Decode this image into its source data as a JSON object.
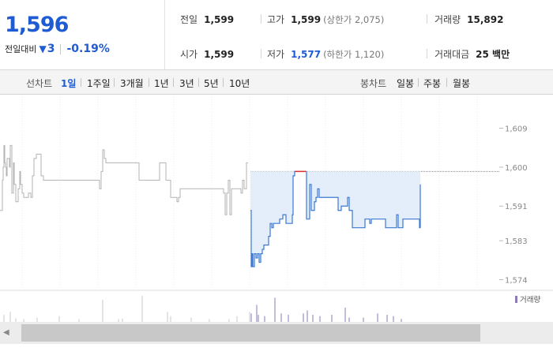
{
  "quote": {
    "price": "1,596",
    "change_label": "전일대비",
    "change_symbol": "▼",
    "change_abs": "3",
    "change_pct": "-0.19%"
  },
  "stats": {
    "prev_close_label": "전일",
    "prev_close": "1,599",
    "high_label": "고가",
    "high": "1,599",
    "upper_limit": "(상한가 2,075)",
    "volume_label": "거래량",
    "volume": "15,892",
    "open_label": "시가",
    "open": "1,599",
    "low_label": "저가",
    "low": "1,577",
    "lower_limit": "(하한가 1,120)",
    "amount_label": "거래대금",
    "amount": "25 백만"
  },
  "toolbar": {
    "line_label": "선차트",
    "line_periods": [
      "1일",
      "1주일",
      "3개월",
      "1년",
      "3년",
      "5년",
      "10년"
    ],
    "active_period": "1일",
    "candle_label": "봉차트",
    "candle_periods": [
      "일봉",
      "주봉",
      "월봉"
    ]
  },
  "colors": {
    "accent": "#1f5bd3",
    "today_line": "#3a78d4",
    "today_fill": "#e4eefb",
    "prev_line": "#b3b3b3",
    "up": "#e03030",
    "volume": "#8a7ab8"
  },
  "chart_data": {
    "type": "line",
    "ylim": [
      1573,
      1610
    ],
    "ytick_labels": [
      "1,609",
      "1,600",
      "1,591",
      "1,583",
      "1,574"
    ],
    "yticks": [
      1609,
      1600,
      1591,
      1583,
      1574
    ],
    "reference_price": 1599,
    "volume_legend": "거래량",
    "series": [
      {
        "x": [
          0,
          3,
          4,
          5,
          6,
          7,
          8,
          9,
          12,
          13,
          15,
          17,
          18,
          20,
          23,
          25,
          26,
          28,
          30,
          33,
          36,
          39,
          41,
          43,
          46,
          52,
          55,
          58,
          62,
          65,
          70,
          80,
          95,
          105,
          115,
          120,
          122,
          126,
          128,
          130,
          132,
          134,
          136,
          140,
          155,
          170,
          176,
          178,
          180,
          182,
          186,
          198,
          202,
          205,
          207,
          210,
          212,
          214,
          216,
          220,
          224,
          226,
          228,
          236,
          250,
          265,
          275,
          280,
          283,
          285,
          287,
          289,
          291,
          293,
          298,
          303,
          305,
          307,
          309,
          312,
          314
        ],
        "y": [
          1590,
          1597,
          1600,
          1605,
          1601,
          1600,
          1598,
          1602,
          1600,
          1605,
          1594,
          1601,
          1596,
          1592,
          1595,
          1599,
          1596,
          1594,
          1593,
          1593,
          1594,
          1593,
          1598,
          1602,
          1603,
          1598,
          1597,
          1597,
          1597,
          1597,
          1597,
          1597,
          1597,
          1597,
          1597,
          1597,
          1597,
          1595,
          1599,
          1604,
          1602,
          1601,
          1601,
          1601,
          1601,
          1601,
          1597,
          1597,
          1597,
          1597,
          1597,
          1597,
          1601,
          1601,
          1601,
          1597,
          1597,
          1597,
          1593,
          1593,
          1592,
          1593,
          1595,
          1595,
          1595,
          1595,
          1595,
          1595,
          1594,
          1589,
          1594,
          1597,
          1589,
          1595,
          1595,
          1595,
          1594,
          1597,
          1595,
          1601,
          1601
        ]
      },
      {
        "x": [
          317,
          318,
          319,
          320,
          322,
          324,
          326,
          328,
          330,
          332,
          334,
          338,
          340,
          342,
          344,
          346,
          350,
          354,
          358,
          362,
          366,
          370,
          371,
          372,
          373,
          375,
          377,
          380,
          383,
          385,
          386,
          387,
          388,
          390,
          392,
          394,
          396,
          398,
          400,
          402,
          404,
          406,
          410,
          415,
          420,
          423,
          426,
          428,
          430,
          432,
          434,
          436,
          438,
          440,
          442,
          446,
          450,
          460,
          462,
          468,
          470,
          474,
          476,
          480,
          484,
          486,
          488,
          490,
          494,
          498,
          500,
          502,
          504,
          508,
          510,
          515,
          520,
          525,
          530,
          531,
          532
        ],
        "y": [
          1590,
          1577,
          1580,
          1577,
          1580,
          1579,
          1580,
          1578,
          1580,
          1581,
          1582,
          1582,
          1584,
          1587,
          1586,
          1587,
          1587,
          1588,
          1589,
          1587,
          1587,
          1589,
          1598,
          1598,
          1599,
          1599,
          1599,
          1599,
          1599,
          1599,
          1599,
          1599,
          1588,
          1588,
          1596,
          1590,
          1590,
          1592,
          1593,
          1595,
          1593,
          1593,
          1593,
          1593,
          1593,
          1593,
          1593,
          1590,
          1590,
          1591,
          1591,
          1591,
          1591,
          1593,
          1590,
          1586,
          1586,
          1586,
          1588,
          1587,
          1588,
          1588,
          1588,
          1588,
          1588,
          1588,
          1586,
          1586,
          1586,
          1586,
          1586,
          1589,
          1586,
          1586,
          1588,
          1588,
          1588,
          1588,
          1588,
          1586,
          1596
        ]
      }
    ],
    "volume": {
      "x": [
        5,
        13,
        20,
        30,
        47,
        75,
        100,
        130,
        150,
        155,
        180,
        212,
        216,
        242,
        265,
        290,
        300,
        316,
        318,
        325,
        327,
        335,
        348,
        356,
        365,
        384,
        389,
        396,
        405,
        420,
        437,
        442,
        460,
        478,
        490,
        498,
        508
      ],
      "v": [
        0.25,
        0.35,
        0.12,
        0.1,
        0.15,
        0.2,
        0.1,
        0.78,
        0.1,
        0.12,
        0.92,
        0.35,
        0.2,
        0.15,
        0.1,
        0.1,
        0.2,
        0.35,
        0.3,
        0.6,
        0.25,
        0.2,
        0.85,
        0.3,
        0.25,
        0.3,
        0.4,
        0.25,
        0.2,
        0.25,
        0.5,
        0.15,
        0.15,
        0.3,
        0.25,
        0.2,
        0.1
      ]
    }
  }
}
